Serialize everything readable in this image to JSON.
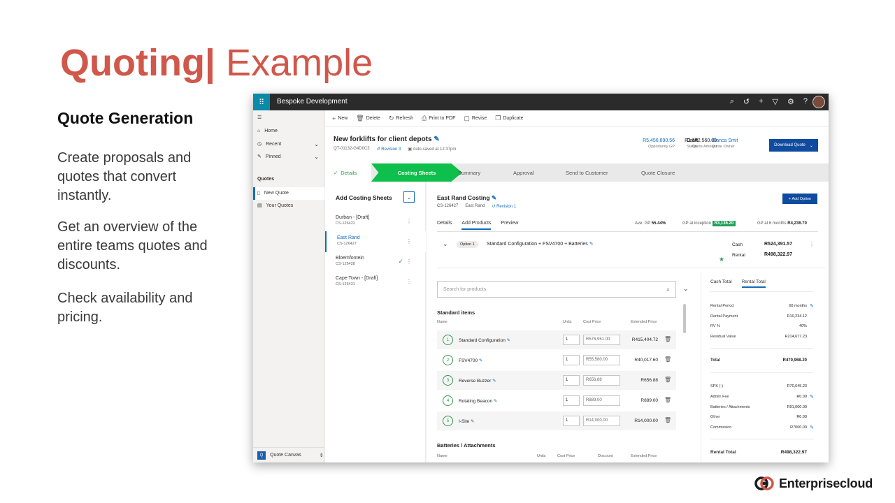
{
  "slide": {
    "title_bold": "Quoting|",
    "title_light": " Example",
    "section_title": "Quote Generation",
    "bullets": [
      "Create proposals and quotes that convert instantly.",
      "Get an overview of the entire teams quotes and discounts.",
      "Check availability and pricing."
    ],
    "logo_text": "Enterprisecloud",
    "colors": {
      "accent": "#d0574a"
    }
  },
  "app": {
    "title": "Bespoke Development",
    "topbar_icons": [
      "search-icon",
      "history-icon",
      "plus-icon",
      "filter-icon",
      "gear-icon",
      "help-icon"
    ]
  },
  "nav": {
    "items": [
      {
        "label": "Home",
        "icon": "home-icon"
      },
      {
        "label": "Recent",
        "icon": "clock-icon"
      },
      {
        "label": "Pinned",
        "icon": "pin-icon"
      }
    ],
    "group": "Quotes",
    "quotes_items": [
      {
        "label": "New Quote",
        "icon": "document-icon"
      },
      {
        "label": "Your Quotes",
        "icon": "list-icon"
      }
    ],
    "area": {
      "badge": "Q",
      "label": "Quote Canvas"
    }
  },
  "commands": [
    "New",
    "Delete",
    "Refresh",
    "Print to PDF",
    "Revise",
    "Duplicate"
  ],
  "record": {
    "title": "New forklifts for client depots",
    "number": "QT-01132-G4D0C3",
    "revision": "Revision 3",
    "autosave": "Auto-saved at 12:37pm",
    "kpis": [
      {
        "value": "R5,456,890.56",
        "label": "Opportunity GP"
      },
      {
        "value": "R1,542,560.00",
        "label": "Quote Amount"
      },
      {
        "value": "Draft",
        "label": "Status"
      },
      {
        "value": "Bianca Smit",
        "label": "Quote Owner"
      }
    ],
    "download": "Download Quote"
  },
  "stages": [
    "Details",
    "Costing Sheets",
    "Summary",
    "Approval",
    "Send to Customer",
    "Quote Closure"
  ],
  "sheets": {
    "title": "Add Costing Sheets",
    "items": [
      {
        "name": "Durban - [Draft]",
        "code": "CS-126422"
      },
      {
        "name": "East Rand",
        "code": "CS-126427"
      },
      {
        "name": "Bloemfontein",
        "code": "CS-126428"
      },
      {
        "name": "Cape Town - [Draft]",
        "code": "CS-126431"
      }
    ]
  },
  "costing": {
    "title": "East Rand Costing",
    "code": "CS-126427",
    "region": "East Rand",
    "revision": "Revision 1",
    "add_option": "+ Add Option",
    "tabs": [
      "Details",
      "Add Products",
      "Preview"
    ],
    "avg_gp_label": "Ave. GP",
    "avg_gp": "55.44%",
    "gp_inception_label": "GP at inception",
    "gp_inception": "R3,136.20",
    "gp_6m_label": "GP at 6 months",
    "gp_6m": "R4,236.70",
    "option_badge": "Option 1",
    "option_name": "Standard Configuration + FSV4700 + Batteries",
    "cash_label": "Cash",
    "cash_value": "R524,391.57",
    "rental_label": "Rental",
    "rental_value": "R498,322.97",
    "search_placeholder": "Search for products",
    "standard_title": "Standard items",
    "headers": {
      "name": "Name",
      "units": "Units",
      "cost": "Cost Price",
      "ext": "Extended Price",
      "discount": "Discount"
    },
    "items": [
      {
        "n": "1",
        "name": "Standard Configuration",
        "units": "1",
        "cost": "R576,951.00",
        "ext": "R415,404.72"
      },
      {
        "n": "2",
        "name": "FSV4700",
        "units": "1",
        "cost": "R55,580.00",
        "ext": "R40,017.60"
      },
      {
        "n": "3",
        "name": "Reverse Buzzer",
        "units": "1",
        "cost": "R656.88",
        "ext": "R656.88"
      },
      {
        "n": "4",
        "name": "Rotating Beacon",
        "units": "1",
        "cost": "R889.00",
        "ext": "R889.00"
      },
      {
        "n": "5",
        "name": "I-Site",
        "units": "1",
        "cost": "R14,000.00",
        "ext": "R14,000.00"
      }
    ],
    "batteries_title": "Batteries / Attachments"
  },
  "totals": {
    "tabs": [
      "Cash Total",
      "Rental Total"
    ],
    "rows1": [
      {
        "label": "Rental Period",
        "value": "60 months"
      },
      {
        "label": "Rental Payment",
        "value": "R10,234.12"
      },
      {
        "label": "RV %",
        "value": "40%"
      },
      {
        "label": "Residual Value",
        "value": "R214,677.23"
      }
    ],
    "total": {
      "label": "Total",
      "value": "R470,968.20"
    },
    "rows2": [
      {
        "label": "SPK (-)",
        "value": "R70,645.23"
      },
      {
        "label": "Admin Fee",
        "value": "R0.00"
      },
      {
        "label": "Batteries / Attachments",
        "value": "R91,000.00"
      },
      {
        "label": "Other",
        "value": "R0.00"
      },
      {
        "label": "Commission",
        "value": "R7000.00"
      }
    ],
    "rental_total": {
      "label": "Rental Total",
      "value": "R498,322.97"
    }
  }
}
